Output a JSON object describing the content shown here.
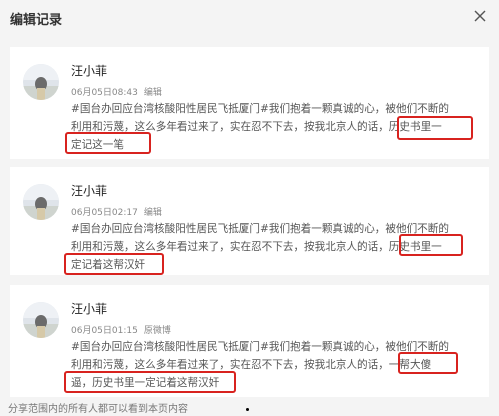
{
  "dialog": {
    "title": "编辑记录",
    "close_icon": "close-icon"
  },
  "records": [
    {
      "user": "汪小菲",
      "time": "06月05日08:43",
      "action": "编辑",
      "lines": [
        "#国台办回应台湾核酸阳性居民飞抵厦门#我们抱着一颗真诚的心，被他们不断的",
        "利用和污蔑，这么多年看过来了，实在忍不下去，按我北京人的话，历史书里一",
        "定记这一笔"
      ]
    },
    {
      "user": "汪小菲",
      "time": "06月05日02:17",
      "action": "编辑",
      "lines": [
        "#国台办回应台湾核酸阳性居民飞抵厦门#我们抱着一颗真诚的心，被他们不断的",
        "利用和污蔑，这么多年看过来了，实在忍不下去，按我北京人的话，历史书里一",
        "定记着这帮汉奸"
      ]
    },
    {
      "user": "汪小菲",
      "time": "06月05日01:15",
      "action": "原微博",
      "lines": [
        "#国台办回应台湾核酸阳性居民飞抵厦门#我们抱着一颗真诚的心，被他们不断的",
        "利用和污蔑，这么多年看过来了，实在忍不下去，按我北京人的话，一帮大傻",
        "逼，历史书里一定记着这帮汉奸"
      ]
    }
  ],
  "footer": "分享范围内的所有人都可以看到本页内容",
  "colors": {
    "highlight": "#d8231f",
    "card_bg": "#ffffff",
    "page_bg": "#f4f4f4"
  }
}
